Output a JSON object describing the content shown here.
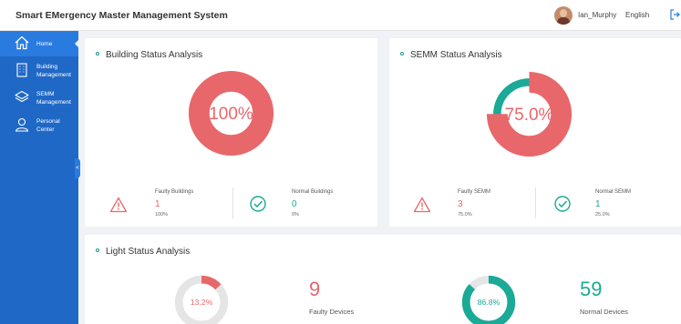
{
  "app": {
    "title": "Smart EMergency Master Management System"
  },
  "header": {
    "username": "Ian_Murphy",
    "language": "English",
    "avatar_icon": "user-avatar",
    "logout_icon": "logout-icon"
  },
  "sidebar": {
    "items": [
      {
        "label": "Home",
        "icon": "home-icon",
        "active": true
      },
      {
        "label": "Building\nManagement",
        "icon": "building-icon",
        "active": false
      },
      {
        "label": "SEMM\nManagement",
        "icon": "layers-icon",
        "active": false
      },
      {
        "label": "Personal\nCenter",
        "icon": "user-icon",
        "active": false
      }
    ],
    "collapse_glyph": "<"
  },
  "building_status": {
    "title": "Building Status Analysis",
    "center_label": "100%",
    "faulty_fraction": 1.0,
    "faulty": {
      "label": "Faulty Buildings",
      "value": "1",
      "percent": "100%"
    },
    "normal": {
      "label": "Normal Buildings",
      "value": "0",
      "percent": "0%"
    }
  },
  "semm_status": {
    "title": "SEMM Status Analysis",
    "center_label": "75.0%",
    "faulty_fraction": 0.75,
    "faulty": {
      "label": "Faulty SEMM",
      "value": "3",
      "percent": "75.0%"
    },
    "normal": {
      "label": "Normal SEMM",
      "value": "1",
      "percent": "25.0%"
    }
  },
  "light_status": {
    "title": "Light Status Analysis",
    "faulty": {
      "center_label": "13.2%",
      "fraction": 0.132,
      "count": "9",
      "label": "Faulty Devices"
    },
    "normal": {
      "center_label": "86.8%",
      "fraction": 0.868,
      "count": "59",
      "label": "Normal Devices"
    }
  },
  "colors": {
    "sidebar": "#1f68c5",
    "fault": "#e8676b",
    "normal": "#1aaa96",
    "track": "#e5e5e5",
    "accent": "#1f9c8e"
  }
}
